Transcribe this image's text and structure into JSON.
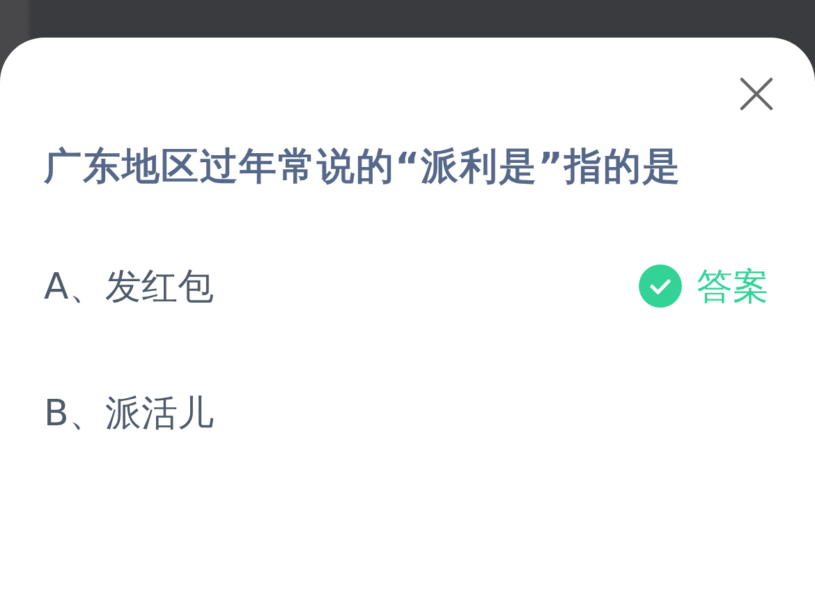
{
  "question": "广东地区过年常说的“派利是”指的是",
  "answer_label": "答案",
  "options": [
    {
      "label": "A、发红包",
      "correct": true
    },
    {
      "label": "B、派活儿",
      "correct": false
    }
  ]
}
